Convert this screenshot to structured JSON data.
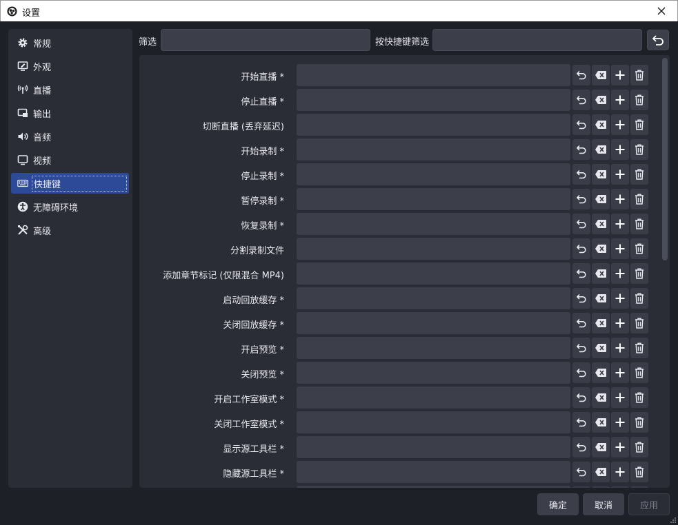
{
  "window": {
    "title": "设置"
  },
  "sidebar": {
    "items": [
      {
        "label": "常规",
        "icon": "gear-icon"
      },
      {
        "label": "外观",
        "icon": "appearance-icon"
      },
      {
        "label": "直播",
        "icon": "broadcast-icon"
      },
      {
        "label": "输出",
        "icon": "output-icon"
      },
      {
        "label": "音频",
        "icon": "speaker-icon"
      },
      {
        "label": "视频",
        "icon": "monitor-icon"
      },
      {
        "label": "快捷键",
        "icon": "keyboard-icon",
        "active": true
      },
      {
        "label": "无障碍环境",
        "icon": "accessibility-icon"
      },
      {
        "label": "高级",
        "icon": "tools-icon"
      }
    ]
  },
  "filter": {
    "label": "筛选",
    "value": "",
    "hotkey_label": "按快捷键筛选",
    "hotkey_value": ""
  },
  "hotkeys": {
    "rows": [
      {
        "label": "开始直播 *"
      },
      {
        "label": "停止直播 *"
      },
      {
        "label": "切断直播 (丢弃延迟)"
      },
      {
        "label": "开始录制 *"
      },
      {
        "label": "停止录制 *"
      },
      {
        "label": "暂停录制 *"
      },
      {
        "label": "恢复录制 *"
      },
      {
        "label": "分割录制文件"
      },
      {
        "label": "添加章节标记 (仅限混合 MP4)"
      },
      {
        "label": "启动回放缓存 *"
      },
      {
        "label": "关闭回放缓存 *"
      },
      {
        "label": "开启预览 *"
      },
      {
        "label": "关闭预览 *"
      },
      {
        "label": "开启工作室模式 *"
      },
      {
        "label": "关闭工作室模式 *"
      },
      {
        "label": "显示源工具栏 *"
      },
      {
        "label": "隐藏源工具栏 *"
      },
      {
        "label": ""
      }
    ]
  },
  "footer": {
    "ok": "确定",
    "cancel": "取消",
    "apply": "应用"
  },
  "colors": {
    "accent": "#2c4a97",
    "background": "#1e2028",
    "panel": "#2b2d36",
    "field": "#3c3e4a"
  }
}
